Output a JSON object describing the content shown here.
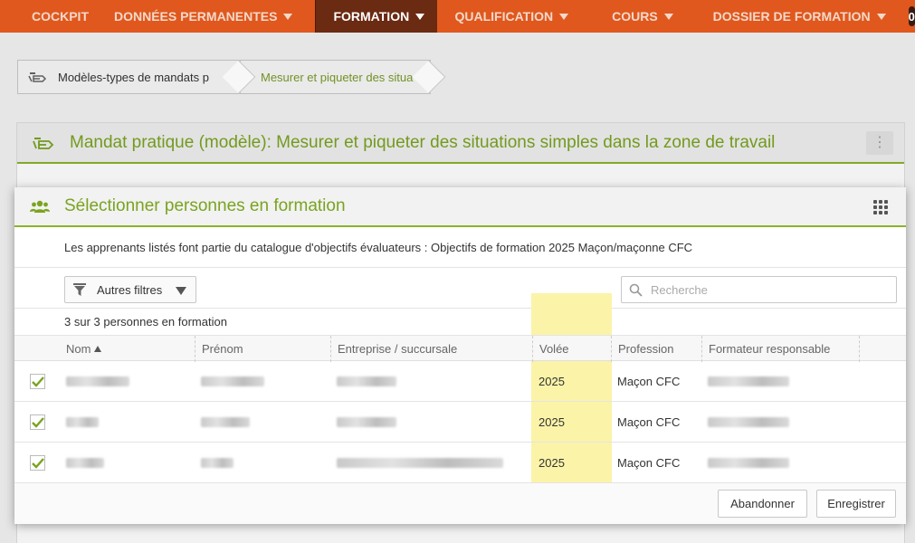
{
  "nav": {
    "items": [
      {
        "label": "COCKPIT",
        "caret": false
      },
      {
        "label": "DONNÉES PERMANENTES",
        "caret": true
      },
      {
        "label": "FORMATION",
        "caret": true
      },
      {
        "label": "QUALIFICATION",
        "caret": true
      },
      {
        "label": "COURS",
        "caret": true
      },
      {
        "label": "DOSSIER DE FORMATION",
        "caret": true
      }
    ],
    "active_index": 2,
    "badge_count": "0",
    "favorites_icon": "star-icon"
  },
  "breadcrumb": {
    "items": [
      "Modèles-types de mandats p",
      "Mesurer et piqueter des situa"
    ]
  },
  "page": {
    "title": "Mandat pratique (modèle): Mesurer et piqueter des situations simples dans la zone de travail",
    "menu_icon": "more-vertical-icon"
  },
  "modal": {
    "title": "Sélectionner personnes en formation",
    "info": "Les apprenants listés font partie du catalogue d'objectifs évaluateurs : Objectifs de formation 2025 Maçon/maçonne CFC",
    "filter_label": "Autres filtres",
    "search_placeholder": "Recherche",
    "count_text": "3 sur 3 personnes en formation",
    "columns": [
      "Nom",
      "Prénom",
      "Entreprise / succursale",
      "Volée",
      "Profession",
      "Formateur responsable"
    ],
    "rows": [
      {
        "checked": true,
        "volee": "2025",
        "profession": "Maçon CFC"
      },
      {
        "checked": true,
        "volee": "2025",
        "profession": "Maçon CFC"
      },
      {
        "checked": true,
        "volee": "2025",
        "profession": "Maçon CFC"
      }
    ],
    "buttons": {
      "cancel": "Abandonner",
      "save": "Enregistrer"
    }
  },
  "colors": {
    "nav_bg": "#e0581d",
    "nav_active": "#6b2a12",
    "accent_green": "#8ab42a",
    "title_green": "#7aa320",
    "highlight": "#fbf3a8"
  }
}
